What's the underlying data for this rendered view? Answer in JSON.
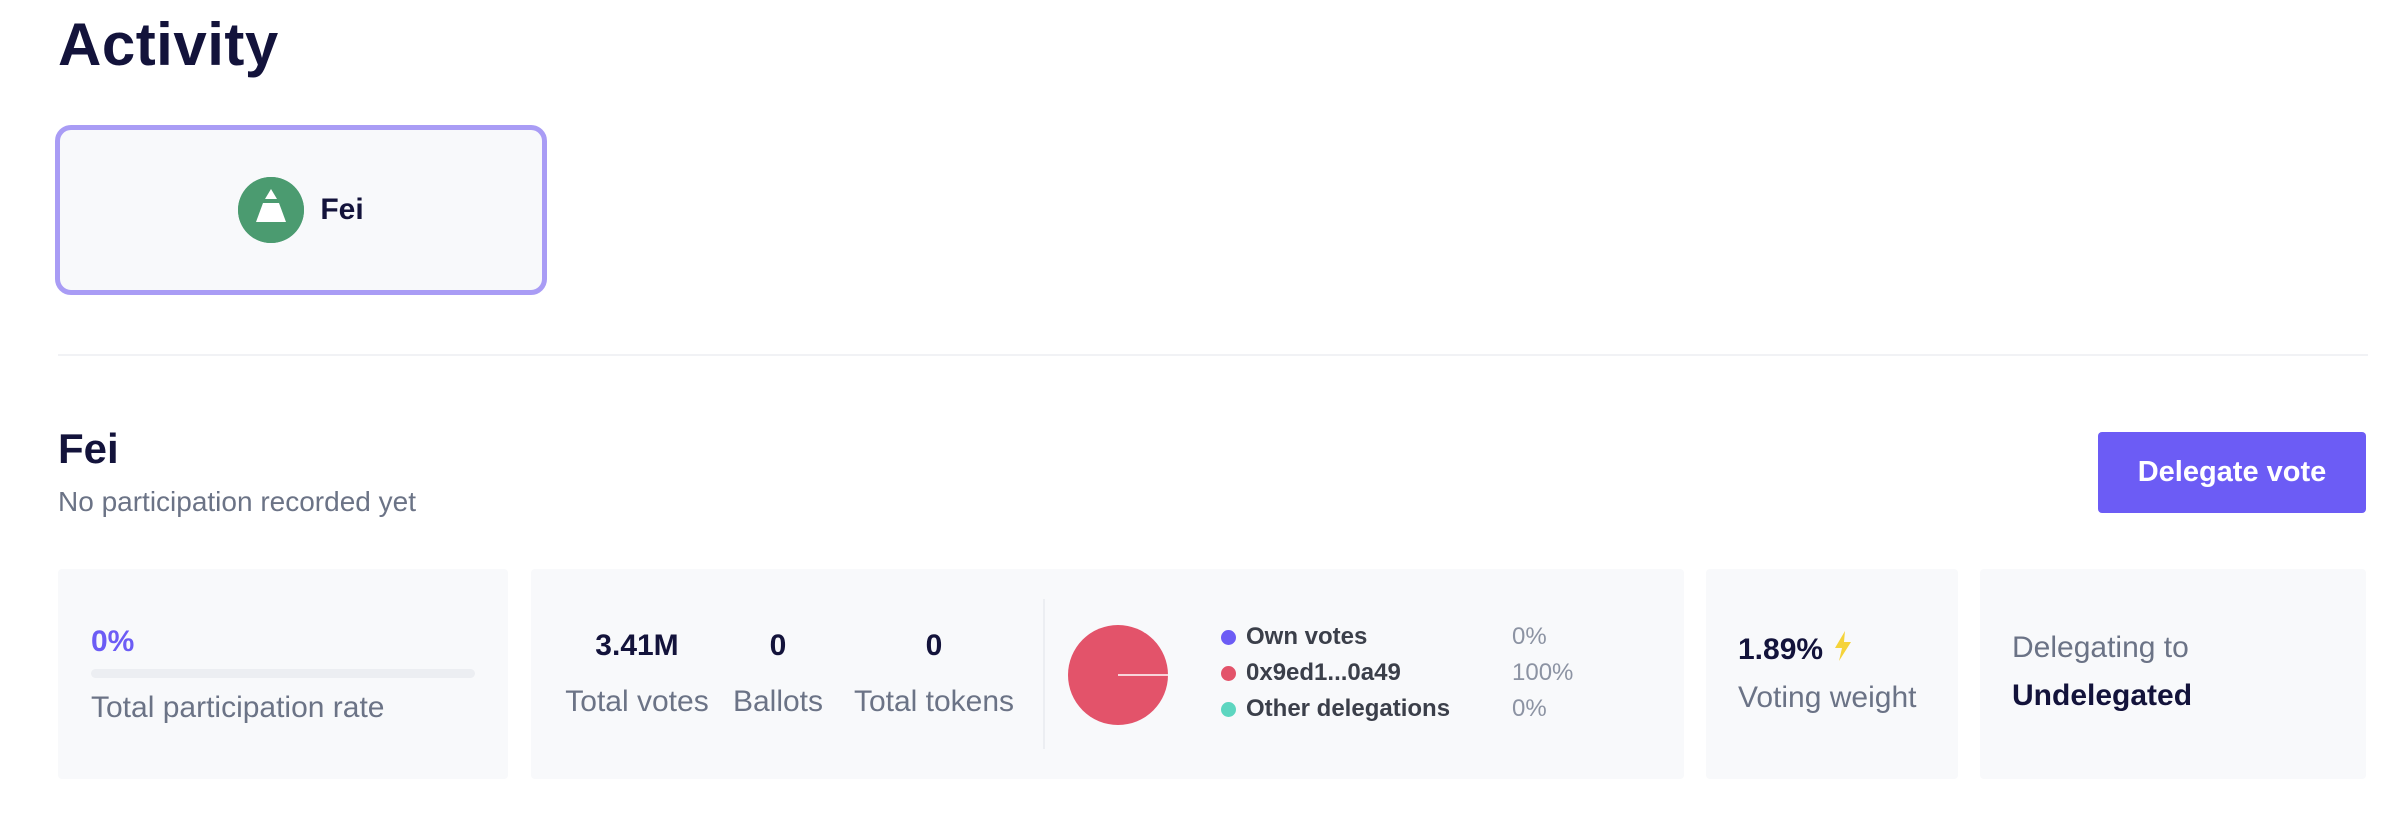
{
  "page": {
    "title": "Activity"
  },
  "dao_selector": {
    "name": "Fei",
    "logo_icon": "fei-logo-icon",
    "logo_color": "#4b9b70"
  },
  "section": {
    "title": "Fei",
    "subtitle": "No participation recorded yet",
    "delegate_button": "Delegate vote"
  },
  "participation": {
    "rate": "0%",
    "rate_value": 0,
    "label": "Total participation rate"
  },
  "stats": [
    {
      "value": "3.41M",
      "label": "Total votes"
    },
    {
      "value": "0",
      "label": "Ballots"
    },
    {
      "value": "0",
      "label": "Total tokens"
    }
  ],
  "distribution": {
    "items": [
      {
        "name": "Own votes",
        "pct": "0%",
        "value": 0,
        "color": "#6c5cf5"
      },
      {
        "name": "0x9ed1...0a49",
        "pct": "100%",
        "value": 100,
        "color": "#e3536a"
      },
      {
        "name": "Other delegations",
        "pct": "0%",
        "value": 0,
        "color": "#5dd6c0"
      }
    ]
  },
  "voting_weight": {
    "value": "1.89%",
    "label": "Voting weight",
    "icon": "lightning-icon",
    "icon_color": "#f5d33a"
  },
  "delegating": {
    "label": "Delegating to",
    "value": "Undelegated"
  },
  "colors": {
    "accent": "#6c5cf5",
    "heading": "#13133b",
    "muted": "#6b7386",
    "panel": "#f8f9fb"
  }
}
